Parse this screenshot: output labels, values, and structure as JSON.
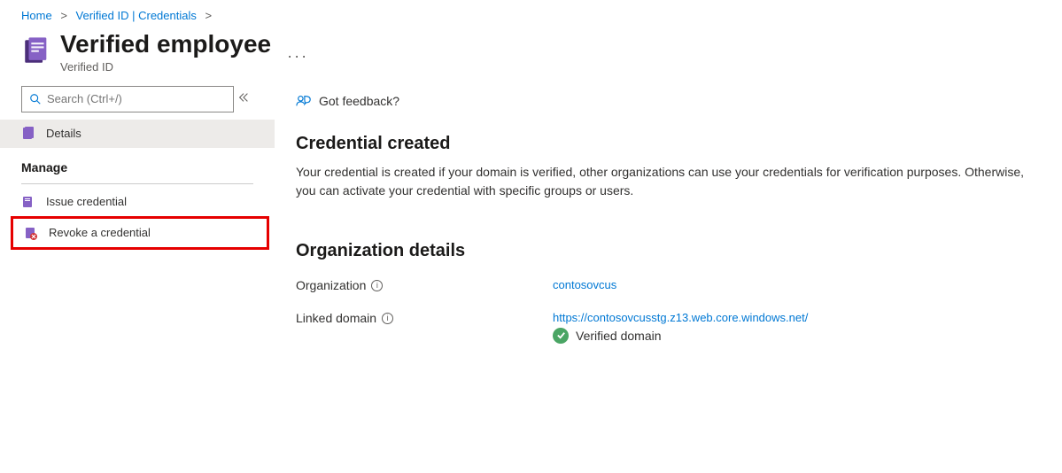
{
  "breadcrumb": {
    "home": "Home",
    "verified_id": "Verified ID | Credentials"
  },
  "header": {
    "title": "Verified employee",
    "subtitle": "Verified ID"
  },
  "sidebar": {
    "search_placeholder": "Search (Ctrl+/)",
    "items": {
      "details": "Details",
      "manage_header": "Manage",
      "issue": "Issue credential",
      "revoke": "Revoke a credential"
    }
  },
  "main": {
    "feedback": "Got feedback?",
    "created_heading": "Credential created",
    "created_body": "Your credential is created if your domain is verified, other organizations can use your credentials for verification purposes. Otherwise, you can activate your credential with specific groups or users.",
    "org_heading": "Organization details",
    "org_label": "Organization",
    "org_value": "contosovcus",
    "domain_label": "Linked domain",
    "domain_url": "https://contosovcusstg.z13.web.core.windows.net/",
    "verified_text": "Verified domain"
  }
}
